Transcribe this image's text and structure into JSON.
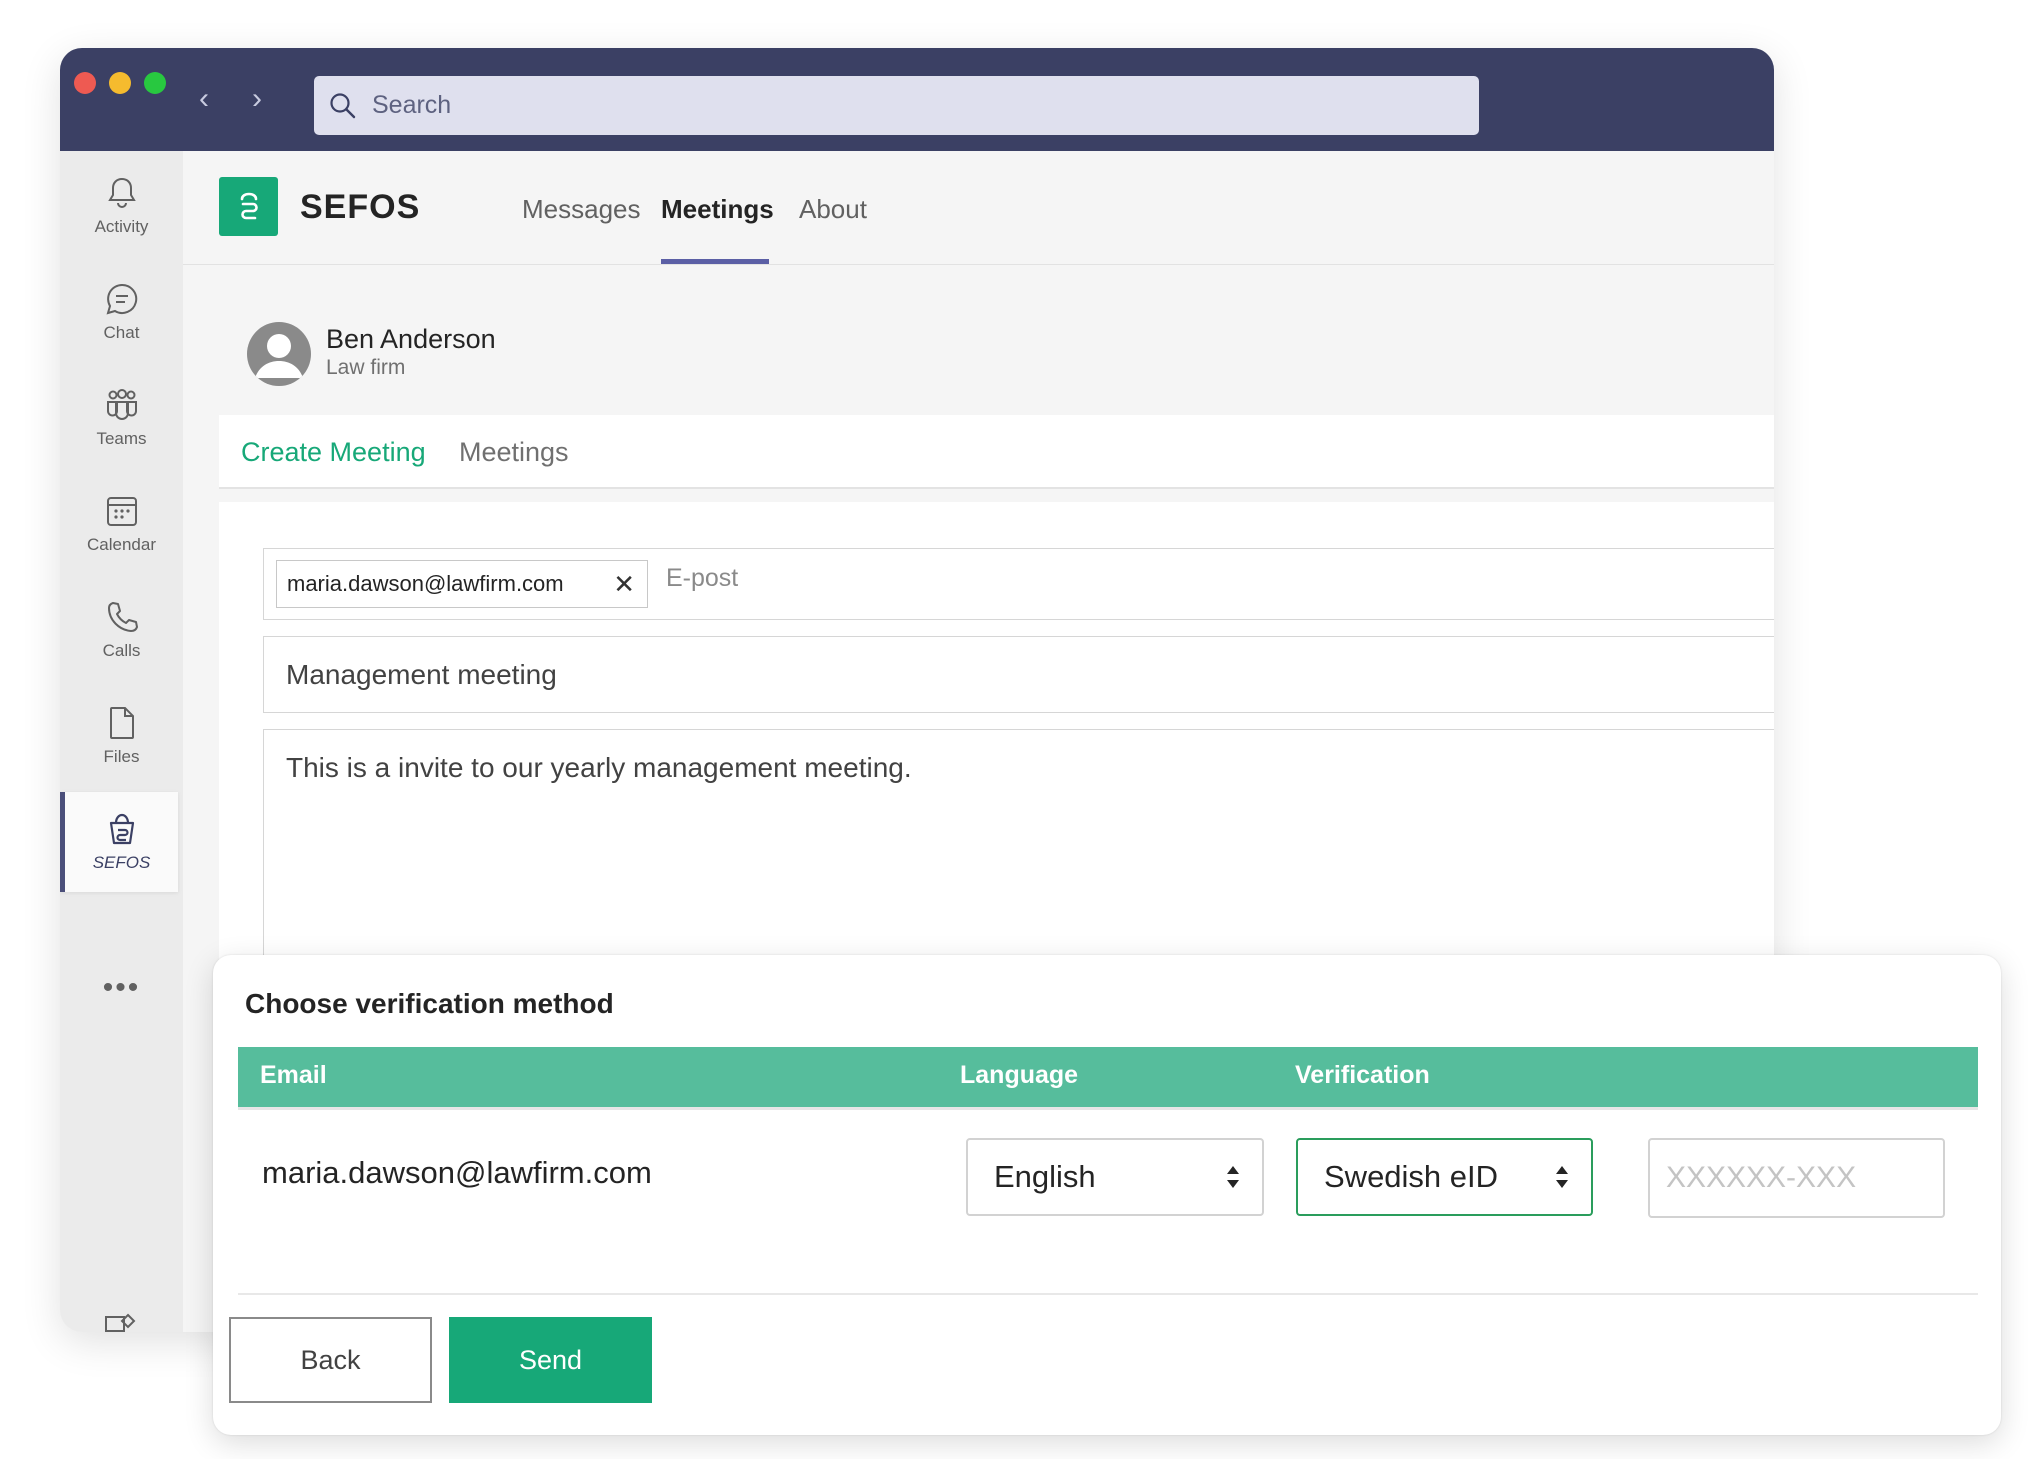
{
  "window": {
    "search": {
      "placeholder": "Search"
    }
  },
  "rail": {
    "items": [
      {
        "label": "Activity",
        "icon": "bell-icon"
      },
      {
        "label": "Chat",
        "icon": "chat-icon"
      },
      {
        "label": "Teams",
        "icon": "teams-icon"
      },
      {
        "label": "Calendar",
        "icon": "calendar-icon"
      },
      {
        "label": "Calls",
        "icon": "phone-icon"
      },
      {
        "label": "Files",
        "icon": "file-icon"
      },
      {
        "label": "SEFOS",
        "icon": "sefos-icon",
        "active": true
      }
    ],
    "more": "•••"
  },
  "header": {
    "brand": "SEFOS",
    "tabs": [
      {
        "label": "Messages"
      },
      {
        "label": "Meetings",
        "active": true
      },
      {
        "label": "About"
      }
    ]
  },
  "user": {
    "name": "Ben Anderson",
    "subtitle": "Law firm"
  },
  "subtabs": {
    "create": "Create Meeting",
    "list": "Meetings"
  },
  "form": {
    "recipient_chip": "maria.dawson@lawfirm.com",
    "email_placeholder": "E-post",
    "subject": "Management meeting",
    "body": "This is a invite to our yearly management meeting."
  },
  "modal": {
    "title": "Choose verification method",
    "columns": [
      "Email",
      "Language",
      "Verification"
    ],
    "row": {
      "email": "maria.dawson@lawfirm.com",
      "language": "English",
      "verification": "Swedish eID",
      "id_placeholder": "XXXXXX-XXX"
    },
    "back_label": "Back",
    "send_label": "Send"
  },
  "colors": {
    "titlebar": "#3b4064",
    "accent_green": "#17a878",
    "table_header": "#56bd9c",
    "tab_underline": "#5b5fa5"
  }
}
